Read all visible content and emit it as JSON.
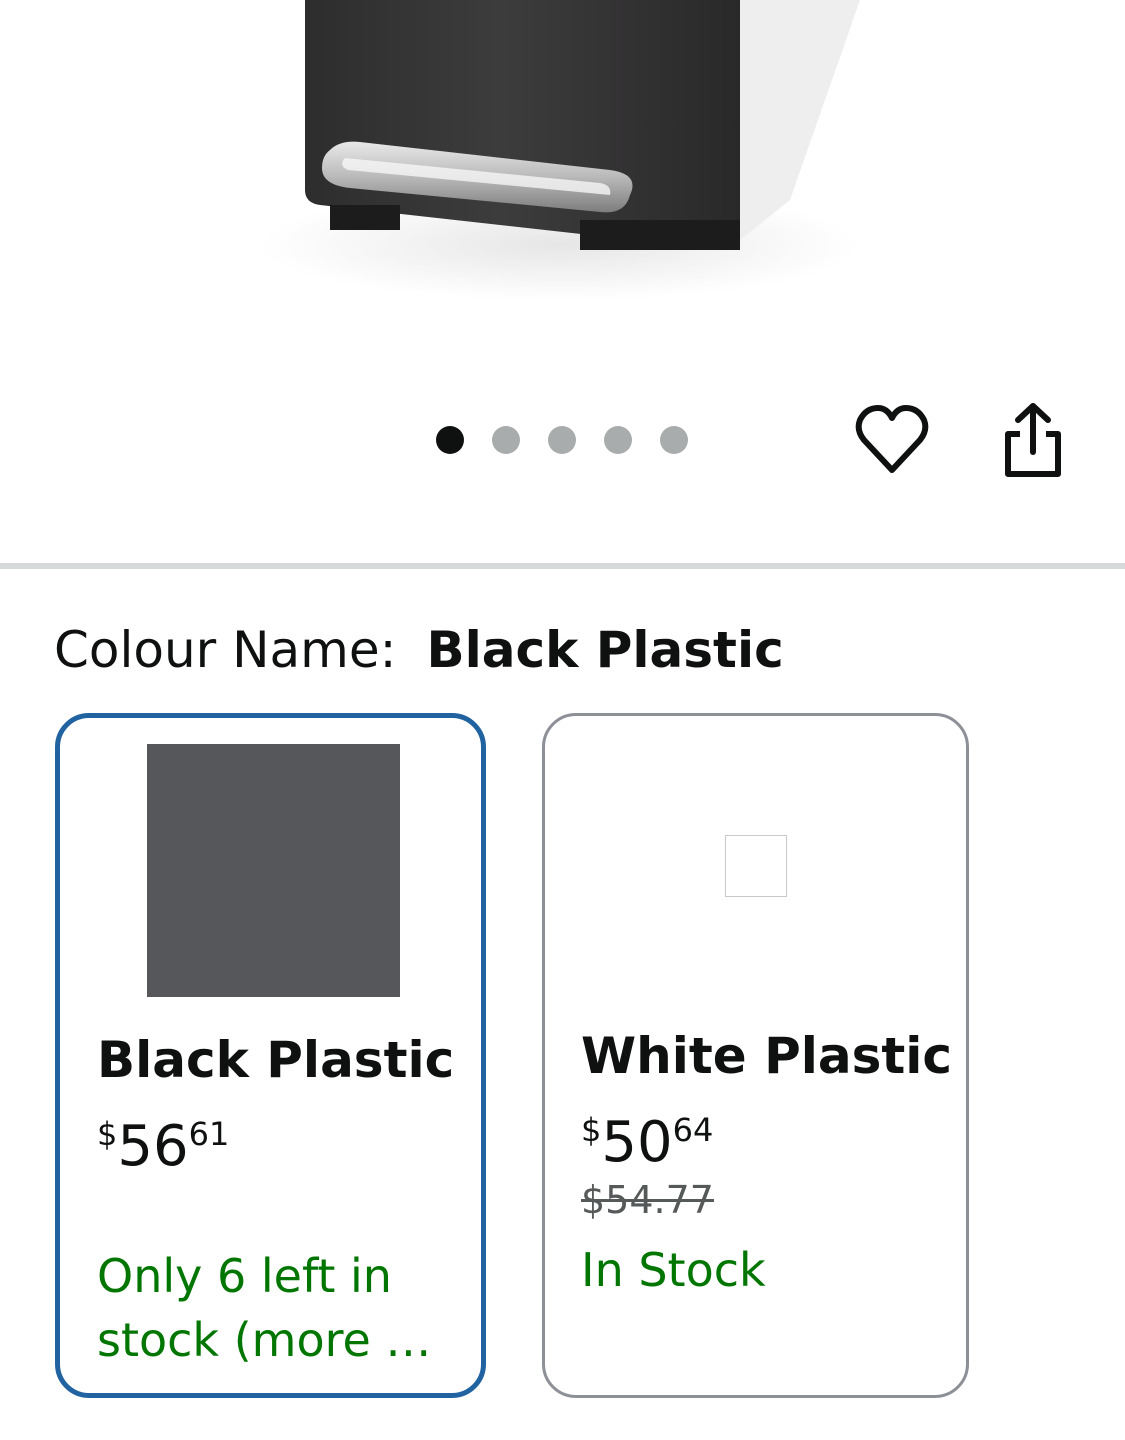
{
  "pager": {
    "count": 5,
    "active_index": 0
  },
  "colour": {
    "label": "Colour Name:",
    "selected": "Black Plastic"
  },
  "options": [
    {
      "name": "Black Plastic",
      "currency": "$",
      "price_whole": "56",
      "price_fraction": "61",
      "stock": "Only 6 left in stock (more …",
      "swatch_color": "#55575b",
      "selected": true
    },
    {
      "name": "White Plastic",
      "currency": "$",
      "price_whole": "50",
      "price_fraction": "64",
      "list_price": "$54.77",
      "stock": "In Stock",
      "swatch_color": "#ffffff",
      "selected": false
    }
  ],
  "colors": {
    "accent": "#2162a1",
    "stock_green": "#007600",
    "dot_inactive": "#a9acac",
    "dot_active": "#0f1111"
  },
  "icons": {
    "wishlist": "heart-icon",
    "share": "share-icon"
  }
}
